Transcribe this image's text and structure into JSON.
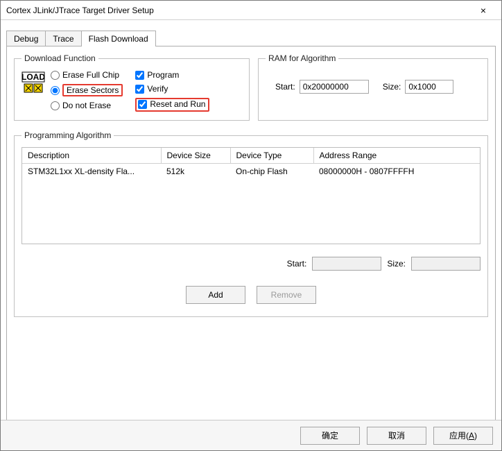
{
  "window": {
    "title": "Cortex JLink/JTrace Target Driver Setup"
  },
  "tabs": {
    "debug": "Debug",
    "trace": "Trace",
    "flash": "Flash Download",
    "active": "flash"
  },
  "download_function": {
    "legend": "Download Function",
    "radios": {
      "erase_full_chip": {
        "label": "Erase Full Chip",
        "selected": false
      },
      "erase_sectors": {
        "label": "Erase Sectors",
        "selected": true
      },
      "do_not_erase": {
        "label": "Do not Erase",
        "selected": false
      }
    },
    "checks": {
      "program": {
        "label": "Program",
        "checked": true
      },
      "verify": {
        "label": "Verify",
        "checked": true
      },
      "reset_and_run": {
        "label": "Reset and Run",
        "checked": true
      }
    }
  },
  "ram": {
    "legend": "RAM for Algorithm",
    "start_label": "Start:",
    "start_value": "0x20000000",
    "size_label": "Size:",
    "size_value": "0x1000"
  },
  "algo": {
    "legend": "Programming Algorithm",
    "headers": {
      "desc": "Description",
      "size": "Device Size",
      "type": "Device Type",
      "range": "Address Range"
    },
    "rows": [
      {
        "desc": "STM32L1xx XL-density Fla...",
        "size": "512k",
        "type": "On-chip Flash",
        "range": "08000000H - 0807FFFFH"
      }
    ],
    "start_label": "Start:",
    "start_value": "",
    "size_label": "Size:",
    "size_value": ""
  },
  "buttons": {
    "add": "Add",
    "remove": "Remove",
    "ok": "确定",
    "cancel": "取消",
    "apply": "应用",
    "apply_mn": "A"
  }
}
